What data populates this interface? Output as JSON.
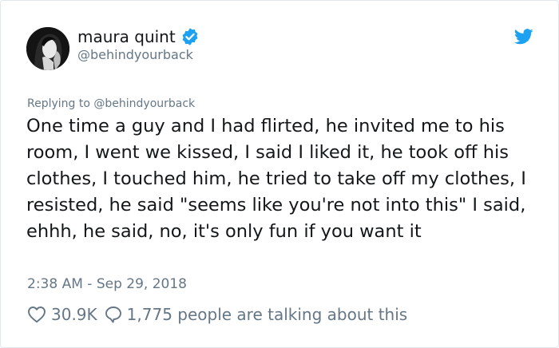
{
  "author": {
    "display_name": "maura quint",
    "handle": "@behindyourback",
    "verified": true
  },
  "reply_context": {
    "prefix": "Replying to ",
    "handle": "@behindyourback"
  },
  "tweet": {
    "text": "One time a guy and I had flirted, he invited me to his room, I went we kissed, I said I liked it, he took off his clothes, I touched him, he tried to take off my clothes, I resisted, he said \"seems like you're not into this\" I said, ehhh, he said, no, it's only fun if you want it",
    "timestamp": "2:38 AM - Sep 29, 2018"
  },
  "stats": {
    "likes": "30.9K",
    "talking": "1,775 people are talking about this"
  },
  "icons": {
    "verified": "verified-badge-icon",
    "bird": "twitter-bird-icon",
    "like": "heart-icon",
    "talk": "speech-bubble-icon"
  },
  "colors": {
    "brand": "#1da1f2",
    "text": "#14171a",
    "secondary": "#657786",
    "border": "#e1e8ed"
  }
}
